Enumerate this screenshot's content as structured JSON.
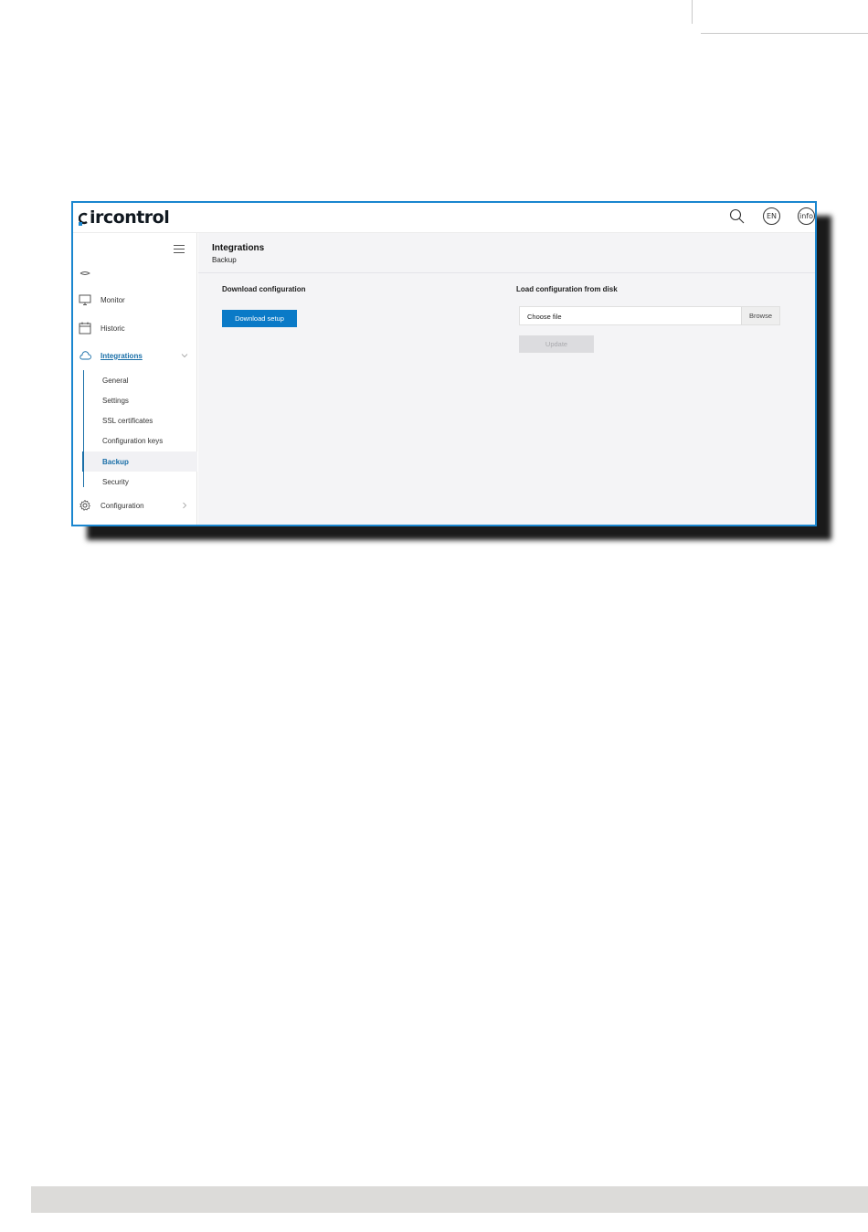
{
  "app": {
    "logo_text": "ircontrol",
    "logo_brand": "circontrol",
    "accent_color": "#0a7ac7",
    "frame_color": "#1a86cf"
  },
  "topbar": {
    "icons": [
      {
        "name": "search-icon"
      },
      {
        "name": "language-icon",
        "label": "EN"
      },
      {
        "name": "info-icon",
        "label": "info"
      }
    ]
  },
  "sidebar": {
    "collapse_icon": "hamburger-icon",
    "items": [
      {
        "label": "Monitor",
        "icon": "monitor-icon"
      },
      {
        "label": "Historic",
        "icon": "calendar-icon"
      },
      {
        "label": "Integrations",
        "icon": "cloud-icon",
        "active": true,
        "expanded": true
      },
      {
        "label": "Configuration",
        "icon": "gear-icon"
      }
    ],
    "subitems": [
      {
        "label": "General"
      },
      {
        "label": "Settings"
      },
      {
        "label": "SSL certificates"
      },
      {
        "label": "Configuration keys"
      },
      {
        "label": "Backup",
        "active": true
      },
      {
        "label": "Security"
      }
    ]
  },
  "page": {
    "title": "Integrations",
    "subtitle": "Backup"
  },
  "download": {
    "title": "Download configuration",
    "button_label": "Download setup"
  },
  "upload": {
    "title": "Load configuration from disk",
    "file_placeholder": "Choose file",
    "browse_label": "Browse",
    "update_label": "Update",
    "update_disabled": true
  }
}
